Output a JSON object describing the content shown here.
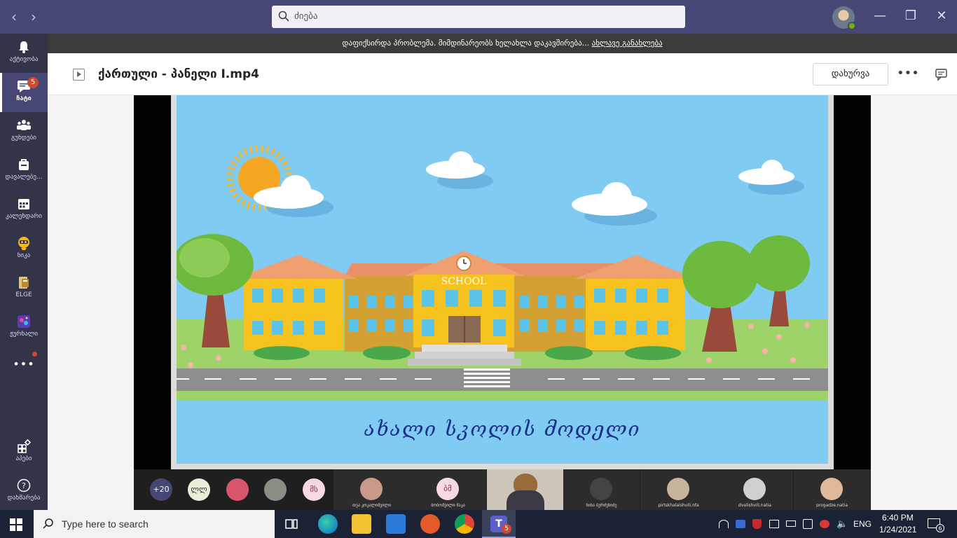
{
  "titlebar": {
    "back_icon": "chevron-left-icon",
    "forward_icon": "chevron-right-icon",
    "search_placeholder": "ძიება",
    "minimize": "—",
    "restore": "❐",
    "close": "✕"
  },
  "rail": {
    "items": [
      {
        "label": "აქტივობა",
        "icon": "bell-icon"
      },
      {
        "label": "ჩატი",
        "icon": "chat-icon",
        "badge": "5"
      },
      {
        "label": "გუნდები",
        "icon": "teams-icon"
      },
      {
        "label": "დავალებე...",
        "icon": "assignments-icon"
      },
      {
        "label": "კალენდარი",
        "icon": "calendar-icon"
      },
      {
        "label": "ნიკა",
        "icon": "bot-icon"
      },
      {
        "label": "ELGE",
        "icon": "elge-icon"
      },
      {
        "label": "ჟურნალი",
        "icon": "journal-icon"
      }
    ],
    "more": "•••",
    "apps_label": "აპები",
    "help_label": "დახმარება"
  },
  "banner": {
    "message": "დაფიქსირდა პრობლემა. მიმდინარეობს ხელახლა დაკავშირება... ",
    "link": "ახლავე განახლება"
  },
  "header": {
    "file_title": "ქართული - პანელი I.mp4",
    "close_label": "დახურვა",
    "more_label": "•••"
  },
  "video": {
    "school_sign": "SCHOOL",
    "caption": "ახალი სკოლის მოდელი"
  },
  "participants": {
    "overflow": "+20",
    "bubbles": [
      {
        "initials": "ლლ",
        "bg": "#e8eed8",
        "fg": "#333"
      },
      {
        "initials": "",
        "bg": "#d9566a",
        "fg": "#fff"
      },
      {
        "initials": "",
        "bg": "#8a8f86",
        "fg": "#fff"
      },
      {
        "initials": "მს",
        "bg": "#f6d9e3",
        "fg": "#8a2c4d"
      }
    ],
    "tiles": [
      {
        "name": "თეა კოკალიშვილი",
        "type": "photo",
        "color": "#c99a8c"
      },
      {
        "name": "ბობოშვილი მაკა",
        "type": "initials",
        "initials": "ბმ",
        "color": "#f6d9e3"
      },
      {
        "name": "",
        "type": "video",
        "color": "#7a6358"
      },
      {
        "name": "ნინა ბურძენიძე",
        "type": "photo",
        "color": "#444"
      },
      {
        "name": "pirtskhalaishvili.nfa",
        "type": "photo",
        "color": "#c8b49a"
      },
      {
        "name": "dvalishvili.natia",
        "type": "photo",
        "color": "#d0d0d0"
      },
      {
        "name": "progadze.natia",
        "type": "photo",
        "color": "#e0b89a"
      }
    ]
  },
  "taskbar": {
    "search_text": "Type here to search",
    "language": "ENG",
    "time": "6:40 PM",
    "date": "1/24/2021",
    "teams_badge": "5",
    "notif_count": "6"
  }
}
